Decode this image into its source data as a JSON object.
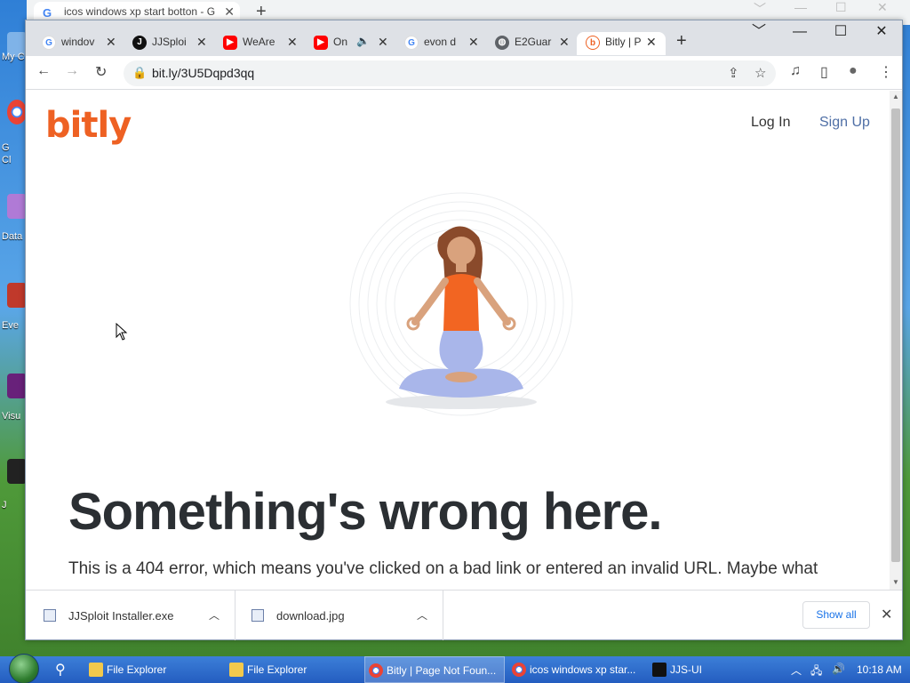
{
  "desktop": {
    "icons": [
      {
        "label": "My C",
        "icon": "computer-icon"
      },
      {
        "label": "G",
        "icon": "chrome-icon"
      },
      {
        "label": "Cl",
        "icon": "chrome-icon"
      },
      {
        "label": "Data",
        "icon": "data-icon"
      },
      {
        "label": "Eve",
        "icon": "app-icon"
      },
      {
        "label": "Visu",
        "icon": "visual-studio-icon"
      },
      {
        "label": "J",
        "icon": "app-icon"
      }
    ]
  },
  "back_window": {
    "tab_title": "icos windows xp start botton - G",
    "new_tab": "+",
    "controls": [
      "﹀",
      "—",
      "☐",
      "✕"
    ]
  },
  "browser": {
    "tabs": [
      {
        "title": "windov",
        "favicon": "google-icon"
      },
      {
        "title": "JJSploi",
        "favicon": "jjsploit-icon"
      },
      {
        "title": "WeAre",
        "favicon": "youtube-icon"
      },
      {
        "title": "On",
        "favicon": "youtube-icon",
        "audio": "🔈"
      },
      {
        "title": "evon d",
        "favicon": "google-icon"
      },
      {
        "title": "E2Guar",
        "favicon": "globe-icon"
      },
      {
        "title": "Bitly | P",
        "favicon": "bitly-icon",
        "active": true
      }
    ],
    "new_tab": "+",
    "window_controls": {
      "dropdown": "﹀",
      "minimize": "—",
      "maximize": "☐",
      "close": "✕"
    },
    "toolbar": {
      "back": "←",
      "forward": "→",
      "reload": "↻",
      "lock": "🔒",
      "url": "bit.ly/3U5Dqpd3qq",
      "share": "⇪",
      "star": "☆",
      "media": "♫",
      "sidepanel": "▯",
      "profile": "●",
      "menu": "⋮"
    }
  },
  "page": {
    "logo": "bitly",
    "login": "Log In",
    "signup": "Sign Up",
    "headline": "Something's wrong here.",
    "body": "This is a 404 error, which means you've clicked on a bad link or entered an invalid URL. Maybe what"
  },
  "downloads": {
    "items": [
      {
        "name": "JJSploit Installer.exe"
      },
      {
        "name": "download.jpg"
      }
    ],
    "show_all": "Show all",
    "close": "✕"
  },
  "taskbar": {
    "items": [
      {
        "label": "File Explorer",
        "icon": "folder-icon"
      },
      {
        "label": "File Explorer",
        "icon": "folder-icon"
      },
      {
        "label": "Bitly | Page Not Foun...",
        "icon": "chrome-icon",
        "active": true
      },
      {
        "label": "icos windows xp star...",
        "icon": "chrome-icon"
      },
      {
        "label": "JJS-UI",
        "icon": "jjsploit-icon"
      }
    ],
    "tray": {
      "chevron": "︿",
      "network": "🖧",
      "volume": "🔊"
    },
    "clock": "10:18 AM"
  },
  "colors": {
    "brand": "#ee6123",
    "signup": "#4f6fa6",
    "headline": "#2b2f33",
    "tabstrip": "#dee1e6",
    "taskbar": "#245dc0"
  }
}
